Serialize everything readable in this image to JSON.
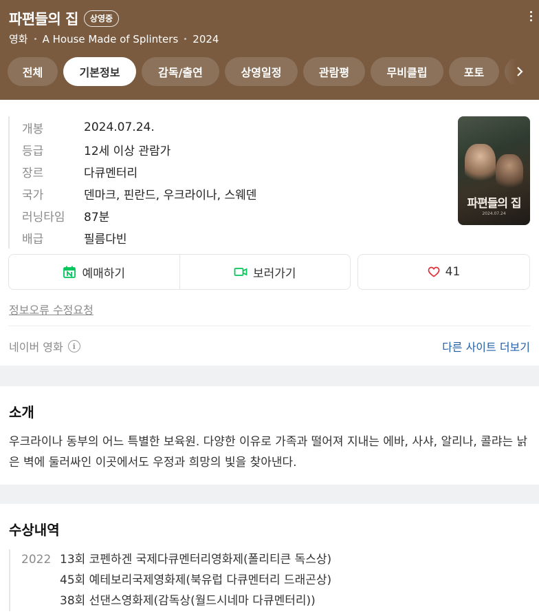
{
  "header": {
    "title": "파편들의 집",
    "badge": "상영중",
    "subtitle": {
      "category": "영화",
      "english_title": "A House Made of Splinters",
      "year": "2024"
    },
    "tabs": [
      "전체",
      "기본정보",
      "감독/출연",
      "상영일정",
      "관람평",
      "무비클립",
      "포토"
    ],
    "active_tab": "기본정보"
  },
  "info": [
    {
      "label": "개봉",
      "value": "2024.07.24."
    },
    {
      "label": "등급",
      "value": "12세 이상 관람가"
    },
    {
      "label": "장르",
      "value": "다큐멘터리"
    },
    {
      "label": "국가",
      "value": "덴마크, 핀란드, 우크라이나, 스웨덴"
    },
    {
      "label": "러닝타임",
      "value": "87분"
    },
    {
      "label": "배급",
      "value": "필름다빈"
    }
  ],
  "poster": {
    "title": "파편들의 집",
    "date": "2024.07.24"
  },
  "actions": {
    "reserve": "예매하기",
    "watch": "보러가기",
    "likes": "41"
  },
  "report_link": "정보오류 수정요청",
  "source": "네이버 영화",
  "other_sites": "다른 사이트 더보기",
  "intro": {
    "title": "소개",
    "text": "우크라이나 동부의 어느 특별한 보육원. 다양한 이유로 가족과 떨어져 지내는 에바, 사샤, 알리나, 콜랴는 낡은 벽에 둘러싸인 이곳에서도 우정과 희망의 빛을 찾아낸다."
  },
  "awards": {
    "title": "수상내역",
    "year": "2022",
    "items": [
      "13회 코펜하겐 국제다큐멘터리영화제(폴리티큰 독스상)",
      "45회 예테보리국제영화제(북유럽 다큐멘터리 드래곤상)",
      "38회 선댄스영화제(감독상(월드시네마 다큐멘터리))"
    ]
  },
  "colors": {
    "header_bg": "#7a5b3f",
    "link_blue": "#1f5fa8",
    "naver_green": "#03c75a",
    "heart_red": "#e0313b"
  }
}
